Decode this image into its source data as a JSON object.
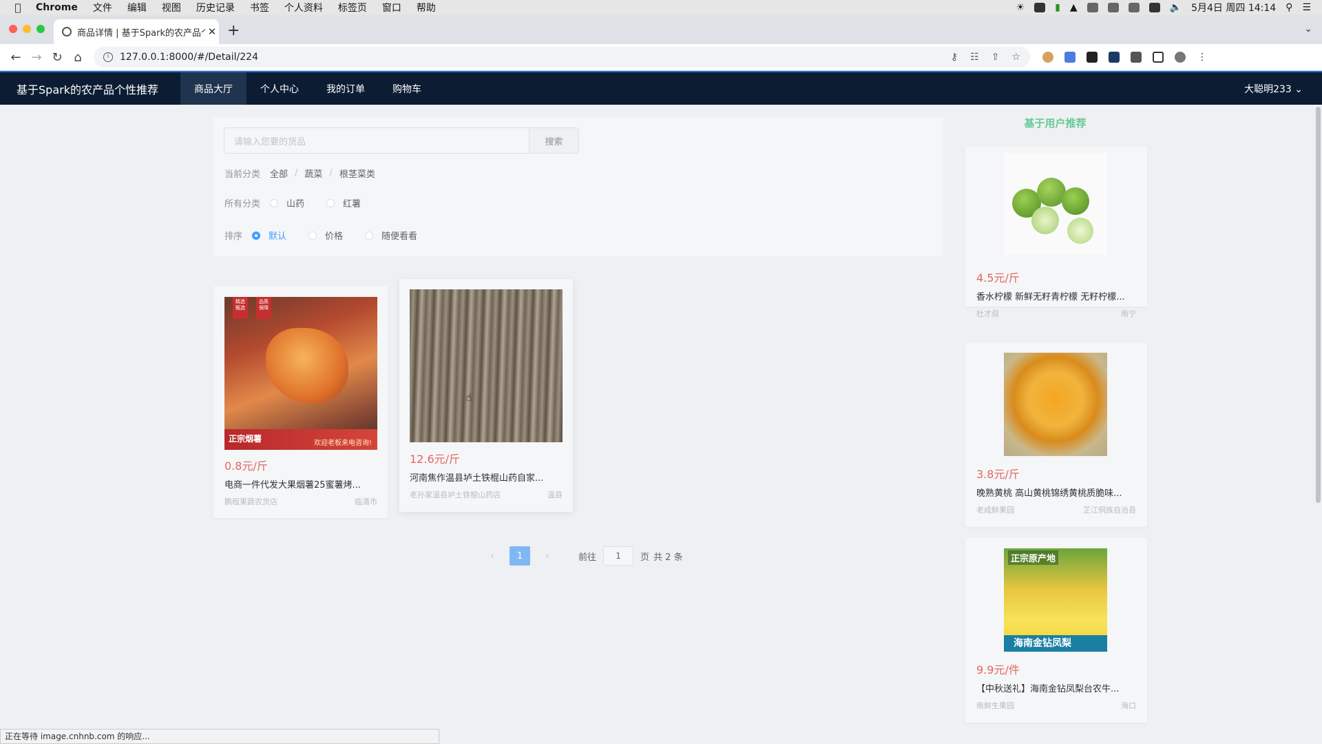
{
  "menubar": {
    "app": "Chrome",
    "items": [
      "文件",
      "编辑",
      "视图",
      "历史记录",
      "书签",
      "个人资料",
      "标签页",
      "窗口",
      "帮助"
    ],
    "clock": "5月4日 周四  14:14"
  },
  "browser": {
    "tab_title": "商品详情 | 基于Spark的农产品个",
    "url": "127.0.0.1:8000/#/Detail/224",
    "status_text": "正在等待 image.cnhnb.com 的响应..."
  },
  "nav": {
    "brand": "基于Spark的农产品个性推荐",
    "items": [
      "商品大厅",
      "个人中心",
      "我的订单",
      "购物车"
    ],
    "active": "商品大厅",
    "user": "大聪明233"
  },
  "filters": {
    "search_placeholder": "请输入您要的货品",
    "search_button": "搜索",
    "current_label": "当前分类",
    "breadcrumb": [
      "全部",
      "蔬菜",
      "根茎菜类"
    ],
    "all_label": "所有分类",
    "categories": [
      "山药",
      "红薯"
    ],
    "sort_label": "排序",
    "sort_options": [
      "默认",
      "价格",
      "随便看看"
    ],
    "sort_selected": "默认"
  },
  "products": [
    {
      "price": "0.8元/斤",
      "name": "电商一件代发大果烟薯25蜜薯烤...",
      "shop": "鹏程果蔬农货店",
      "location": "临清市",
      "image": "sweet-potato"
    },
    {
      "price": "12.6元/斤",
      "name": "河南焦作温县垆土铁棍山药自家...",
      "shop": "老孙家温县垆土铁棍山药店",
      "location": "温县",
      "image": "yam"
    }
  ],
  "pagination": {
    "current": "1",
    "goto_label": "前往",
    "page_value": "1",
    "page_suffix": "页",
    "total": "共 2 条"
  },
  "recommend": {
    "title": "基于用户推荐",
    "items": [
      {
        "price": "4.5元/斤",
        "name": "香水柠檬 新鲜无籽青柠檬 无籽柠檬...",
        "shop": "杜才叔",
        "location": "南宁",
        "image": "lime"
      },
      {
        "price": "3.8元/斤",
        "name": "晚熟黄桃 高山黄桃锦绣黄桃质脆味...",
        "shop": "老成鲜果园",
        "location": "芷江侗族自治县",
        "image": "yellow-peach"
      },
      {
        "price": "9.9元/件",
        "name": "【中秋送礼】海南金钻凤梨台农牛...",
        "shop": "南鲜生果园",
        "location": "海口",
        "image": "pineapple"
      }
    ]
  },
  "image_text": {
    "sweet_potato_tag1": "精选\n甄选",
    "sweet_potato_tag2": "品质\n保障",
    "sweet_potato_banner": "正宗烟薯",
    "sweet_potato_sub": "欢迎老板来电咨询!",
    "pineapple_top": "正宗原产地",
    "pineapple_bottom": "海南金钻凤梨"
  },
  "colors": {
    "nav_bg": "#0c1d33",
    "accent": "#409eff",
    "price": "#e4665e",
    "recommend_title": "#67c996"
  }
}
